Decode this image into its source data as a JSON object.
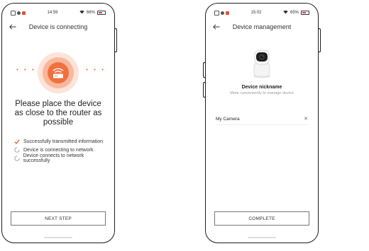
{
  "colors": {
    "accent": "#f0703e",
    "accent_dark": "#e8502e",
    "check": "#e8502e",
    "battery": "#e23b46"
  },
  "screen1": {
    "status": {
      "time": "14:59",
      "battery": "66%",
      "battery_level": 0.66
    },
    "header": {
      "title": "Device is connecting",
      "back_icon": "arrow-left-icon"
    },
    "illustration": {
      "icon": "router-wifi-icon",
      "dots_left": "• • •",
      "dots_right": "• • •"
    },
    "instruction": "Please place the device as close to the router as possible",
    "steps": [
      {
        "label": "Successfully transmitted information",
        "icon": "check-icon",
        "done": true
      },
      {
        "label": "Device is connecting to network",
        "icon": "spinner-icon",
        "done": false
      },
      {
        "label": "Device connects to network successfully",
        "icon": "spinner-icon",
        "done": false
      }
    ],
    "button": {
      "label": "NEXT STEP"
    }
  },
  "screen2": {
    "status": {
      "time": "15:02",
      "battery": "65%",
      "battery_level": 0.65
    },
    "header": {
      "title": "Device management",
      "back_icon": "arrow-left-icon"
    },
    "device_image": "security-camera-icon",
    "nickname_title": "Device nickname",
    "nickname_subtitle": "More conveniently to manage device",
    "name_input": {
      "value": "My Camera",
      "clear_icon": "close-icon"
    },
    "button": {
      "label": "COMPLETE"
    }
  }
}
